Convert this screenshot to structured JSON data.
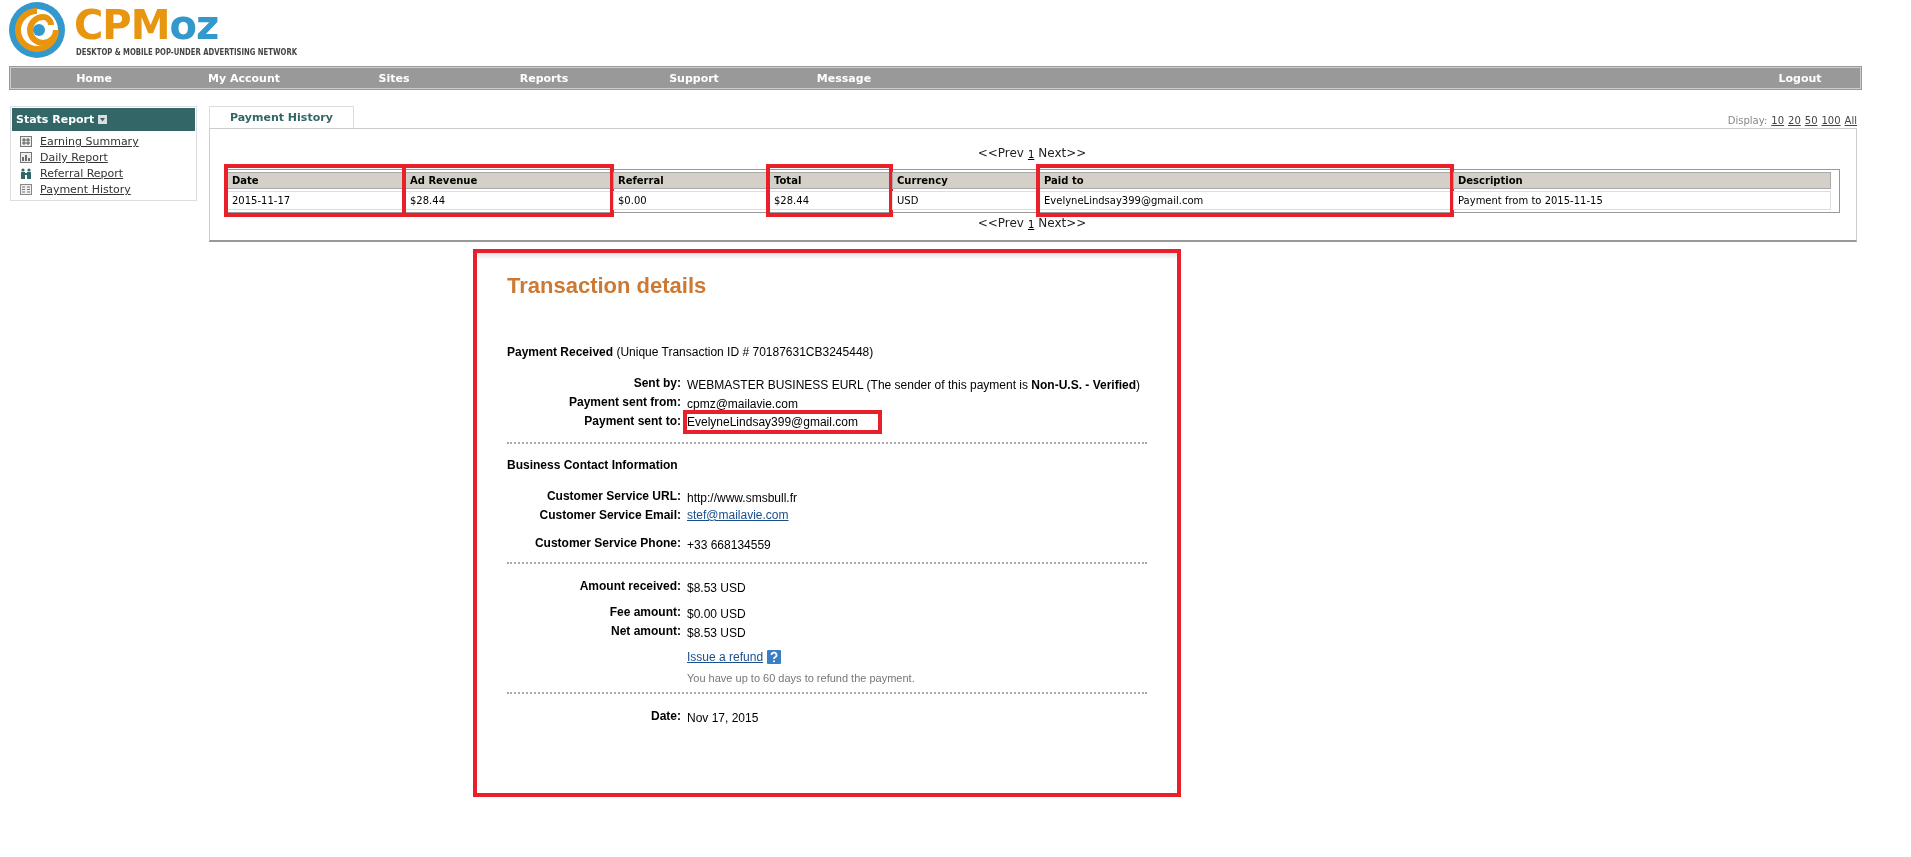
{
  "logo": {
    "name_parts": [
      {
        "text": "CPM",
        "color": "#e8960f"
      },
      {
        "text": "oz",
        "color": "#3399cc"
      }
    ],
    "tagline": "DESKTOP & MOBILE POP-UNDER ADVERTISING NETWORK"
  },
  "nav": {
    "items": [
      {
        "label": "Home"
      },
      {
        "label": "My Account"
      },
      {
        "label": "Sites"
      },
      {
        "label": "Reports"
      },
      {
        "label": "Support"
      },
      {
        "label": "Message"
      }
    ],
    "right": "Logout"
  },
  "sidebar": {
    "title": "Stats Report",
    "items": [
      {
        "label": "Earning Summary",
        "kind": "grid"
      },
      {
        "label": "Daily Report",
        "kind": "bars"
      },
      {
        "label": "Referral Report",
        "kind": "people"
      },
      {
        "label": "Payment History",
        "kind": "list"
      }
    ]
  },
  "tabs": [
    {
      "label": "Payment History",
      "selected": true
    }
  ],
  "display": {
    "label": "Display:",
    "options": [
      "10",
      "20",
      "50",
      "100",
      "All"
    ]
  },
  "pager_top": {
    "prev": "<<Prev",
    "page": "1",
    "next": "Next>>"
  },
  "table": {
    "columns": [
      {
        "title": "Date",
        "highlighted": true
      },
      {
        "title": "Ad Revenue",
        "highlighted": true
      },
      {
        "title": "Referral"
      },
      {
        "title": "Total",
        "highlighted": true
      },
      {
        "title": "Currency"
      },
      {
        "title": "Paid to",
        "highlighted": true
      },
      {
        "title": "Description"
      }
    ],
    "rows": [
      [
        "2015-11-17",
        "$28.44",
        "$0.00",
        "$28.44",
        "USD",
        "EvelyneLindsay399@gmail.com",
        "Payment from to 2015-11-15"
      ]
    ]
  },
  "pager_bottom": {
    "prev": "<<Prev",
    "page": "1",
    "next": "Next>>"
  },
  "transaction": {
    "highlighted": true,
    "title": "Transaction details",
    "received": "**Payment Received** (Unique Transaction ID # 70187631CB3245448)",
    "sections": [
      {
        "rows": [
          {
            "label": "Sent by:",
            "value": "WEBMASTER BUSINESS EURL (The sender of this payment is **Non-U.S. - Verified**)"
          },
          {
            "label": "Payment sent from:",
            "value": "cpmz@mailavie.com"
          },
          {
            "label": "Payment sent to:",
            "value": "EvelyneLindsay399@gmail.com",
            "highlighted": true
          }
        ]
      },
      {
        "heading": "Business Contact Information",
        "rows": [
          {
            "label": "Customer Service URL:",
            "value": "http://www.smsbull.fr"
          },
          {
            "label": "Customer Service Email:",
            "value": "stef@mailavie.com",
            "kind": "link"
          },
          {
            "label": "Customer Service Phone:",
            "value": "+33 668134559"
          }
        ]
      },
      {
        "rows": [
          {
            "label": "Amount received:",
            "value": "$8.53 USD"
          },
          {
            "label": "Fee amount:",
            "value": "$0.00 USD"
          },
          {
            "label": "Net amount:",
            "value": "$8.53 USD"
          }
        ],
        "refund": {
          "link": "Issue a refund",
          "note": "You have up to 60 days to refund the payment."
        }
      },
      {
        "rows": [
          {
            "label": "Date:",
            "value": "Nov 17, 2015"
          }
        ]
      }
    ]
  }
}
